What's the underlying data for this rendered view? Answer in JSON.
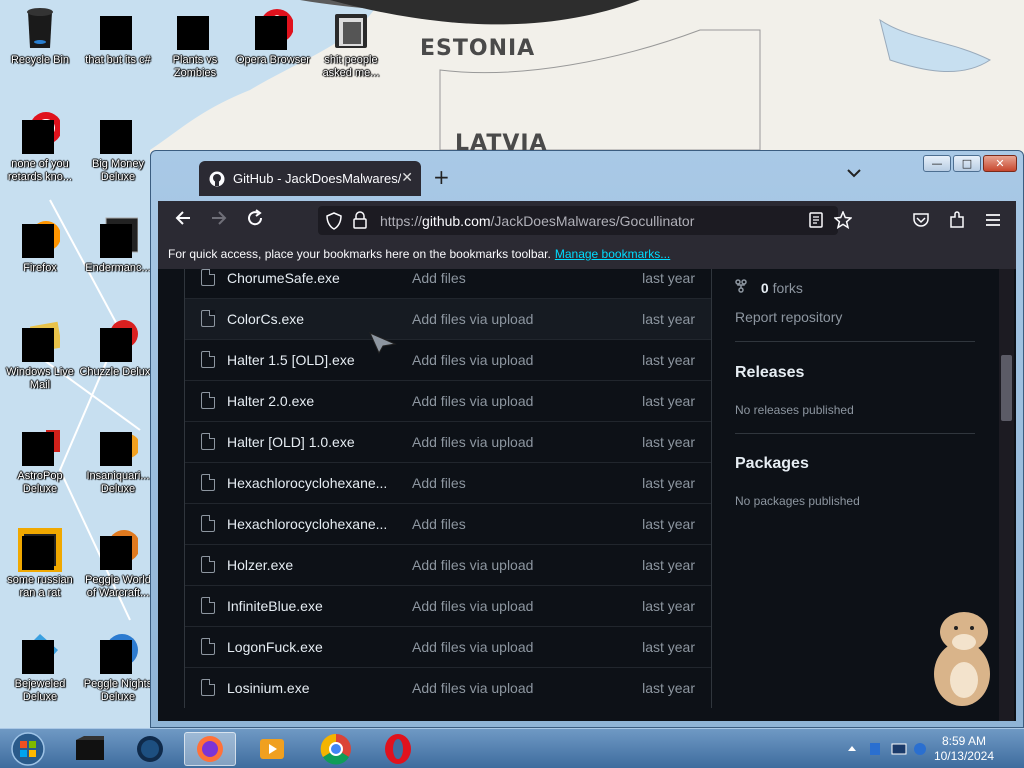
{
  "desktop": {
    "map_labels": [
      "ESTONIA",
      "LATVIA"
    ],
    "icons": [
      {
        "label": "Recycle Bin"
      },
      {
        "label": "that but its c#"
      },
      {
        "label": "Plants vs Zombies"
      },
      {
        "label": "Opera Browser"
      },
      {
        "label": "shit people asked me..."
      },
      {
        "label": "none of you retards kno..."
      },
      {
        "label": "Big Money Deluxe"
      },
      {
        "label": "Firefox"
      },
      {
        "label": "Endermanc..."
      },
      {
        "label": "Windows Live Mail"
      },
      {
        "label": "Chuzzle Deluxe"
      },
      {
        "label": "AstroPop Deluxe"
      },
      {
        "label": "Insaniquari... Deluxe"
      },
      {
        "label": "some russian ran a rat"
      },
      {
        "label": "Peggle World of Warcraft..."
      },
      {
        "label": "Bejeweled Deluxe"
      },
      {
        "label": "Peggle Nights Deluxe"
      }
    ]
  },
  "browser": {
    "tab_title": "GitHub - JackDoesMalwares/Go",
    "tab_close": "✕",
    "new_tab": "+",
    "url_prefix": "https://",
    "url_host": "github.com",
    "url_path": "/JackDoesMalwares/Gocullinator",
    "bookmarks_text": "For quick access, place your bookmarks here on the bookmarks toolbar.",
    "bookmarks_link": "Manage bookmarks...",
    "window_controls": {
      "minimize": "—",
      "maximize": "□",
      "close": "✕"
    }
  },
  "files": [
    {
      "name": "ChorumeSafe.exe",
      "message": "Add files",
      "date": "last year"
    },
    {
      "name": "ColorCs.exe",
      "message": "Add files via upload",
      "date": "last year"
    },
    {
      "name": "Halter 1.5 [OLD].exe",
      "message": "Add files via upload",
      "date": "last year"
    },
    {
      "name": "Halter 2.0.exe",
      "message": "Add files via upload",
      "date": "last year"
    },
    {
      "name": "Halter [OLD] 1.0.exe",
      "message": "Add files via upload",
      "date": "last year"
    },
    {
      "name": "Hexachlorocyclohexane...",
      "message": "Add files",
      "date": "last year"
    },
    {
      "name": "Hexachlorocyclohexane...",
      "message": "Add files",
      "date": "last year"
    },
    {
      "name": "Holzer.exe",
      "message": "Add files via upload",
      "date": "last year"
    },
    {
      "name": "InfiniteBlue.exe",
      "message": "Add files via upload",
      "date": "last year"
    },
    {
      "name": "LogonFuck.exe",
      "message": "Add files via upload",
      "date": "last year"
    },
    {
      "name": "Losinium.exe",
      "message": "Add files via upload",
      "date": "last year"
    }
  ],
  "sidebar": {
    "forks_count": "0",
    "forks_label": "forks",
    "report": "Report repository",
    "releases_title": "Releases",
    "releases_sub": "No releases published",
    "packages_title": "Packages",
    "packages_sub": "No packages published"
  },
  "taskbar": {
    "time": "8:59 AM",
    "date": "10/13/2024"
  }
}
